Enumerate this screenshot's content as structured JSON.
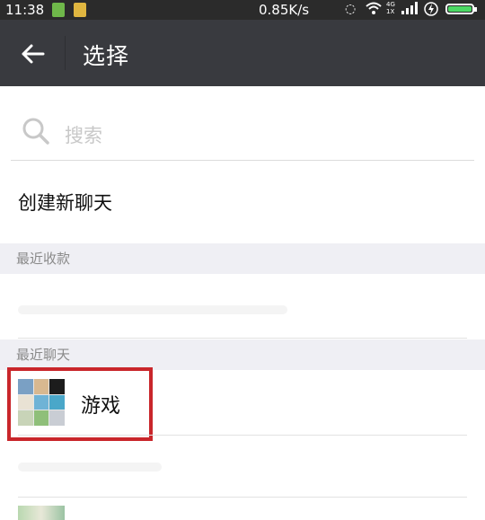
{
  "status_bar": {
    "time": "11:38",
    "network_speed": "0.85K/s",
    "network_label_top": "4G",
    "network_label_bottom": "1X",
    "battery_color": "#4cd964"
  },
  "title_bar": {
    "back_icon": "arrow-left-icon",
    "title": "选择"
  },
  "search": {
    "icon": "search-icon",
    "placeholder": "搜索"
  },
  "new_chat_label": "创建新聊天",
  "sections": {
    "recent_payments": "最近收款",
    "recent_chats": "最近聊天"
  },
  "chats": [
    {
      "name": "游戏",
      "avatar": "group-avatar-grid-icon"
    }
  ],
  "colors": {
    "title_bar": "#393a3f",
    "status_bar": "#2b2b2b",
    "section_bg": "#efeff4",
    "highlight": "#c9262b"
  }
}
